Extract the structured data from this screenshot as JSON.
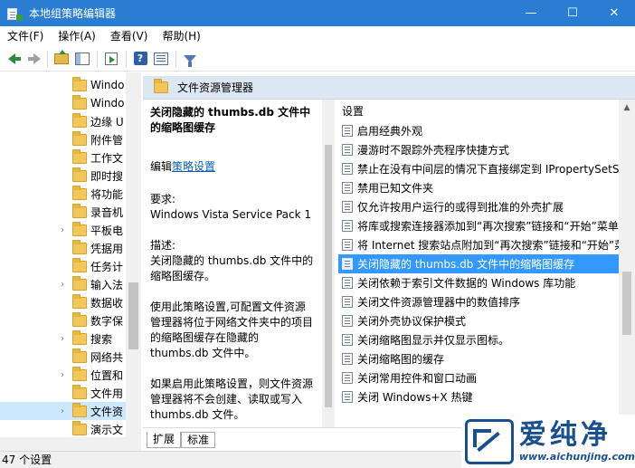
{
  "window": {
    "title": "本地组策略编辑器",
    "minimize": "—",
    "maximize": "☐",
    "close": "✕"
  },
  "menu": [
    "文件(F)",
    "操作(A)",
    "查看(V)",
    "帮助(H)"
  ],
  "toolbar": {
    "help_glyph": "?"
  },
  "tree": {
    "items": [
      {
        "label": "Windo",
        "chevron": ""
      },
      {
        "label": "Windo",
        "chevron": ""
      },
      {
        "label": "边缘 U",
        "chevron": ""
      },
      {
        "label": "附件管",
        "chevron": ""
      },
      {
        "label": "工作文",
        "chevron": ""
      },
      {
        "label": "即时搜",
        "chevron": ""
      },
      {
        "label": "将功能",
        "chevron": ""
      },
      {
        "label": "录音机",
        "chevron": ""
      },
      {
        "label": "平板电",
        "chevron": "›"
      },
      {
        "label": "凭据用",
        "chevron": ""
      },
      {
        "label": "任务计",
        "chevron": ""
      },
      {
        "label": "输入法",
        "chevron": "›"
      },
      {
        "label": "数据收",
        "chevron": ""
      },
      {
        "label": "数字保",
        "chevron": ""
      },
      {
        "label": "搜索",
        "chevron": "›"
      },
      {
        "label": "网络共",
        "chevron": ""
      },
      {
        "label": "位置和",
        "chevron": "›"
      },
      {
        "label": "文件用",
        "chevron": ""
      },
      {
        "label": "文件资",
        "chevron": "›"
      },
      {
        "label": "演示文",
        "chevron": ""
      }
    ],
    "selected_index": 18
  },
  "right_header": {
    "title": "文件资源管理器"
  },
  "description": {
    "title": "关闭隐藏的 thumbs.db 文件中的缩略图缓存",
    "edit_prefix": "编辑",
    "edit_link": "策略设置",
    "req_label": "要求:",
    "req_value": "Windows Vista Service Pack 1",
    "desc_label": "描述:",
    "desc_value": "关闭隐藏的 thumbs.db 文件中的缩略图缓存。",
    "para1": "使用此策略设置,可配置文件资源管理器将位于网络文件夹中的项目的缩略图缓存在隐藏的 thumbs.db 文件中。",
    "para2": "如果启用此策略设置，则文件资源管理器将不会创建、读取或写入 thumbs.db 文件。"
  },
  "settings": {
    "header": "设置",
    "items": [
      "启用经典外观",
      "漫游时不跟踪外壳程序快捷方式",
      "禁止在没有中间层的情况下直接绑定到 IPropertySetSt",
      "禁用已知文件夹",
      "仅允许按用户运行的或得到批准的外壳扩展",
      "将库或搜索连接器添加到“再次搜索”链接和“开始”菜单",
      "将 Internet 搜索站点附加到“再次搜索”链接和“开始”菜",
      "关闭隐藏的 thumbs.db 文件中的缩略图缓存",
      "关闭依赖于索引文件数据的 Windows 库功能",
      "关闭文件资源管理器中的数值排序",
      "关闭外壳协议保护模式",
      "关闭缩略图显示并仅显示图标。",
      "关闭缩略图的缓存",
      "关闭常用控件和窗口动画",
      "关闭 Windows+X 热键"
    ],
    "selected_index": 7
  },
  "tabs": [
    "扩展",
    "标准"
  ],
  "status": "47 个设置",
  "watermark": {
    "cn": "爱纯净",
    "url": "www.aichunjing.com"
  }
}
